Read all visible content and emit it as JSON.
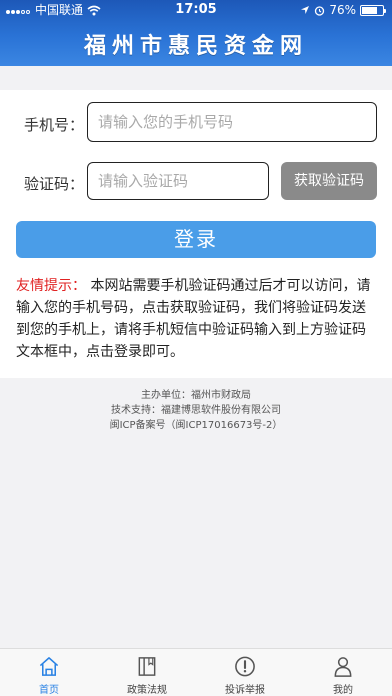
{
  "status_bar": {
    "carrier": "中国联通",
    "time": "17:05",
    "battery": "76%",
    "battery_level": 0.76
  },
  "header": {
    "title": "福州市惠民资金网"
  },
  "form": {
    "phone_label": "手机号：",
    "phone_placeholder": "请输入您的手机号码",
    "phone_value": "",
    "code_label": "验证码：",
    "code_placeholder": "请输入验证码",
    "code_value": "",
    "get_code_label": "获取验证码",
    "login_label": "登录"
  },
  "tip": {
    "label": "友情提示：",
    "text": "本网站需要手机验证码通过后才可以访问，请输入您的手机号码，点击获取验证码，我们将验证码发送到您的手机上，请将手机短信中验证码输入到上方验证码文本框中，点击登录即可。"
  },
  "footer": {
    "sponsor": "主办单位：福州市财政局",
    "tech_support": "技术支持：福建博思软件股份有限公司",
    "icp": "闽ICP备案号（闽ICP17016673号-2）"
  },
  "tabs": [
    {
      "label": "首页",
      "icon": "home-icon",
      "active": true
    },
    {
      "label": "政策法规",
      "icon": "book-icon",
      "active": false
    },
    {
      "label": "投诉举报",
      "icon": "alert-icon",
      "active": false
    },
    {
      "label": "我的",
      "icon": "user-icon",
      "active": false
    }
  ],
  "colors": {
    "header": "#2a73d6",
    "login_button": "#4a9de8",
    "code_button": "#8a8a8a",
    "tip_label": "#e02222",
    "active_tab": "#2a82e4"
  }
}
